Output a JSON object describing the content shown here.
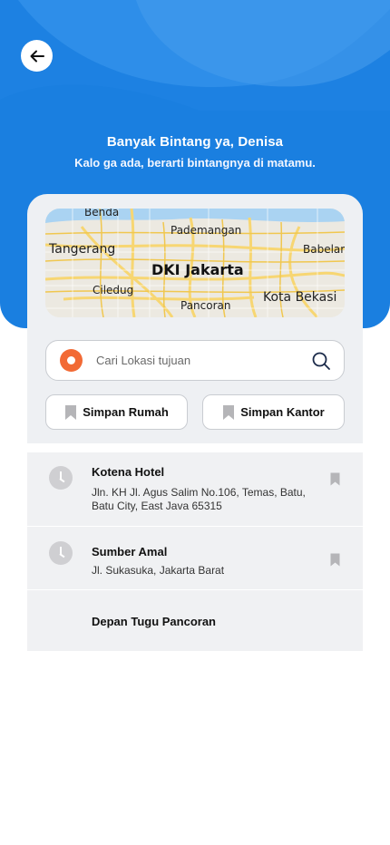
{
  "header": {
    "title": "Banyak Bintang ya, Denisa",
    "subtitle": "Kalo ga ada, berarti bintangnya di matamu.",
    "back_icon": "arrow-left-icon"
  },
  "map": {
    "labels": {
      "bendungan": "Benda",
      "pademangan": "Pademangan",
      "tangerang": "Tangerang",
      "babelan": "Babelan",
      "jakarta": "DKI Jakarta",
      "ciledug": "Ciledug",
      "pancoran": "Pancoran",
      "bekasi": "Kota Bekasi"
    }
  },
  "search": {
    "placeholder": "Cari Lokasi tujuan",
    "value": "",
    "icon": "search-icon"
  },
  "shortcuts": {
    "home_label": "Simpan Rumah",
    "office_label": "Simpan Kantor"
  },
  "history": [
    {
      "name": "Kotena Hotel",
      "address": "Jln. KH Jl. Agus Salim No.106, Temas, Batu, Batu City, East Java 65315"
    },
    {
      "name": "Sumber Amal",
      "address": "Jl. Sukasuka, Jakarta Barat"
    },
    {
      "name": "Depan Tugu Pancoran",
      "address": ""
    }
  ],
  "colors": {
    "primary": "#1a7fe0",
    "pin": "#f26a35",
    "card": "#eef0f3"
  }
}
